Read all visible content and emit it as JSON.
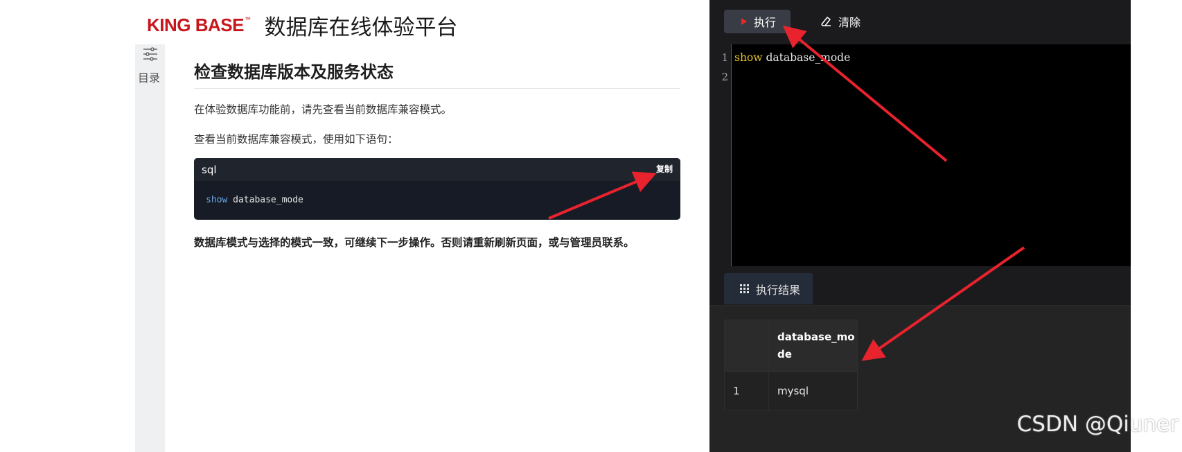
{
  "header": {
    "logo_text": "KING BASE",
    "logo_tm": "™",
    "title": "数据库在线体验平台"
  },
  "sidebar": {
    "toc_label": "目录",
    "toc_icon": "sliders-icon"
  },
  "doc": {
    "heading": "检查数据库版本及服务状态",
    "p1": "在体验数据库功能前，请先查看当前数据库兼容模式。",
    "p2": "查看当前数据库兼容模式，使用如下语句：",
    "code": {
      "lang": "sql",
      "copy_label": "复制",
      "keyword": "show",
      "rest": " database_mode"
    },
    "p3": "数据库模式与选择的模式一致，可继续下一步操作。否则请重新刷新页面，或与管理员联系。"
  },
  "editor": {
    "run_label": "执行",
    "clear_label": "清除",
    "line_numbers": [
      "1",
      "2"
    ],
    "code_keyword": "show",
    "code_rest": " database_mode",
    "result_tab_label": "执行结果",
    "result": {
      "columns": [
        "database_mode"
      ],
      "rows": [
        {
          "index": "1",
          "value": "mysql"
        }
      ]
    }
  },
  "watermark": "CSDN @Qiuner",
  "colors": {
    "brand": "#c8161d",
    "arrow": "#e8232d",
    "editor_bg": "#1b1b1d"
  }
}
